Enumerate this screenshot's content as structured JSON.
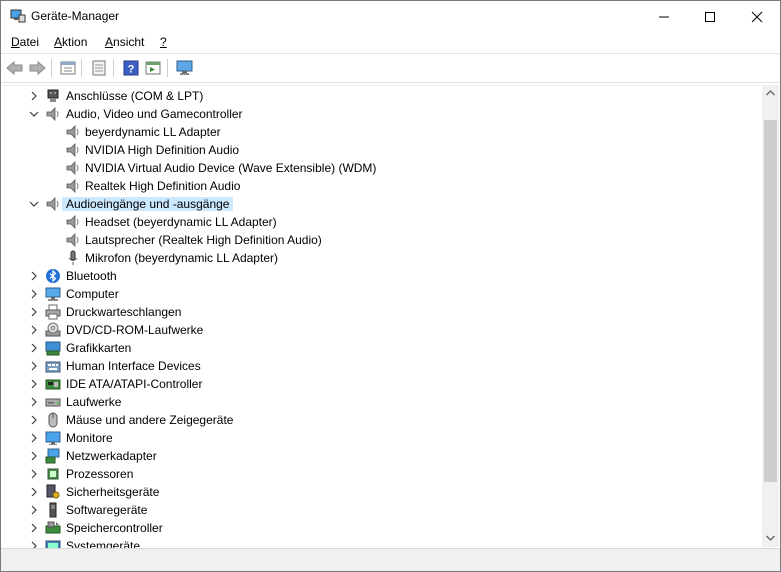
{
  "window": {
    "title": "Geräte-Manager"
  },
  "menu": [
    {
      "label": "Datei",
      "u": "D",
      "rest": "atei"
    },
    {
      "label": "Aktion",
      "u": "A",
      "rest": "ktion"
    },
    {
      "label": "Ansicht",
      "u": "A",
      "rest": "nsicht"
    },
    {
      "label": "?",
      "u": "?",
      "rest": ""
    }
  ],
  "toolbar": [
    "back-arrow",
    "forward-arrow",
    "properties-sheet",
    "driver-details",
    "help",
    "run-action",
    "scan-hardware-monitor"
  ],
  "tree": [
    {
      "label": "Anschlüsse (COM & LPT)",
      "level": 0,
      "expanded": false,
      "icon": "port-icon"
    },
    {
      "label": "Audio, Video und Gamecontroller",
      "level": 0,
      "expanded": true,
      "icon": "speaker-icon"
    },
    {
      "label": "beyerdynamic LL Adapter",
      "level": 1,
      "icon": "speaker-icon"
    },
    {
      "label": "NVIDIA High Definition Audio",
      "level": 1,
      "icon": "speaker-icon"
    },
    {
      "label": "NVIDIA Virtual Audio Device (Wave Extensible) (WDM)",
      "level": 1,
      "icon": "speaker-icon"
    },
    {
      "label": "Realtek High Definition Audio",
      "level": 1,
      "icon": "speaker-icon"
    },
    {
      "label": "Audioeingänge und -ausgänge",
      "level": 0,
      "expanded": true,
      "selected": true,
      "icon": "speaker-icon"
    },
    {
      "label": "Headset (beyerdynamic LL Adapter)",
      "level": 1,
      "icon": "speaker-icon"
    },
    {
      "label": "Lautsprecher (Realtek High Definition Audio)",
      "level": 1,
      "icon": "speaker-icon"
    },
    {
      "label": "Mikrofon (beyerdynamic LL Adapter)",
      "level": 1,
      "icon": "microphone-icon"
    },
    {
      "label": "Bluetooth",
      "level": 0,
      "expanded": false,
      "icon": "bluetooth-icon"
    },
    {
      "label": "Computer",
      "level": 0,
      "expanded": false,
      "icon": "computer-icon"
    },
    {
      "label": "Druckwarteschlangen",
      "level": 0,
      "expanded": false,
      "icon": "printer-icon"
    },
    {
      "label": "DVD/CD-ROM-Laufwerke",
      "level": 0,
      "expanded": false,
      "icon": "disc-drive-icon"
    },
    {
      "label": "Grafikkarten",
      "level": 0,
      "expanded": false,
      "icon": "display-adapter-icon"
    },
    {
      "label": "Human Interface Devices",
      "level": 0,
      "expanded": false,
      "icon": "hid-icon"
    },
    {
      "label": "IDE ATA/ATAPI-Controller",
      "level": 0,
      "expanded": false,
      "icon": "ide-controller-icon"
    },
    {
      "label": "Laufwerke",
      "level": 0,
      "expanded": false,
      "icon": "disk-drive-icon"
    },
    {
      "label": "Mäuse und andere Zeigegeräte",
      "level": 0,
      "expanded": false,
      "icon": "mouse-icon"
    },
    {
      "label": "Monitore",
      "level": 0,
      "expanded": false,
      "icon": "monitor-icon"
    },
    {
      "label": "Netzwerkadapter",
      "level": 0,
      "expanded": false,
      "icon": "network-adapter-icon"
    },
    {
      "label": "Prozessoren",
      "level": 0,
      "expanded": false,
      "icon": "processor-icon"
    },
    {
      "label": "Sicherheitsgeräte",
      "level": 0,
      "expanded": false,
      "icon": "security-device-icon"
    },
    {
      "label": "Softwaregeräte",
      "level": 0,
      "expanded": false,
      "icon": "software-device-icon"
    },
    {
      "label": "Speichercontroller",
      "level": 0,
      "expanded": false,
      "icon": "storage-controller-icon"
    },
    {
      "label": "Systemgeräte",
      "level": 0,
      "expanded": false,
      "icon": "system-device-icon"
    }
  ]
}
